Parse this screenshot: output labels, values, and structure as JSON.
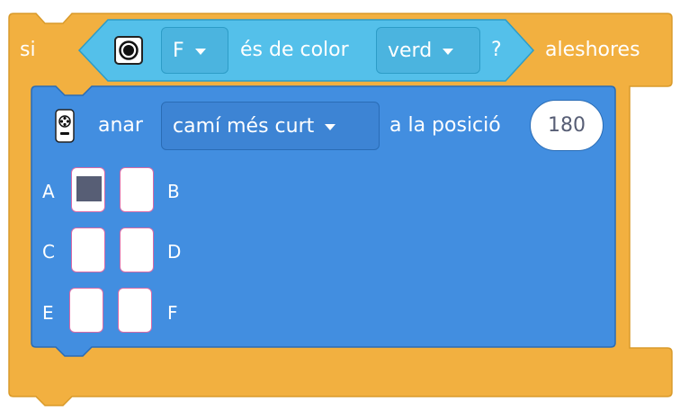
{
  "if_block": {
    "label_if": "si",
    "label_then": "aleshores"
  },
  "condition": {
    "port_value": "F",
    "text": "és de color",
    "color_value": "verd",
    "question": "?"
  },
  "motor_block": {
    "label_go": "anar",
    "direction_value": "camí més curt",
    "label_to_position": "a la posició",
    "position_value": "180",
    "ports": [
      {
        "label": "A",
        "selected": true
      },
      {
        "label": "B",
        "selected": false
      },
      {
        "label": "C",
        "selected": false
      },
      {
        "label": "D",
        "selected": false
      },
      {
        "label": "E",
        "selected": false
      },
      {
        "label": "F",
        "selected": false
      }
    ]
  },
  "colors": {
    "control_orange": "#f2b040",
    "control_border": "#d99a2a",
    "sensor_cyan": "#54c0ea",
    "sensor_border": "#2d9cc7",
    "motor_blue": "#428ee0",
    "motor_border": "#2a6cb5",
    "port_fill": "#575e75",
    "value_text": "#575e75"
  }
}
